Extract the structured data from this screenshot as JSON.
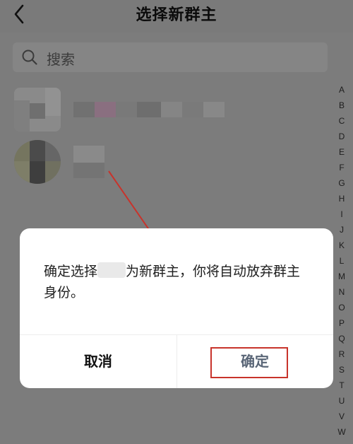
{
  "header": {
    "title": "选择新群主",
    "back_icon": "chevron-left-icon"
  },
  "search": {
    "placeholder": "搜索",
    "icon": "search-icon"
  },
  "index_letters": [
    "A",
    "B",
    "C",
    "D",
    "E",
    "F",
    "G",
    "H",
    "I",
    "J",
    "K",
    "L",
    "M",
    "N",
    "O",
    "P",
    "Q",
    "R",
    "S",
    "T",
    "U",
    "V",
    "W"
  ],
  "dialog": {
    "message_part1": "确定选择",
    "message_part2": "为新群主，你将自动放弃群主身份。",
    "cancel_label": "取消",
    "confirm_label": "确定"
  },
  "colors": {
    "overlay": "#7c7c7c",
    "dialog_bg": "#ffffff",
    "annotation_red": "#c8332b",
    "confirm_text": "#5a6677"
  }
}
